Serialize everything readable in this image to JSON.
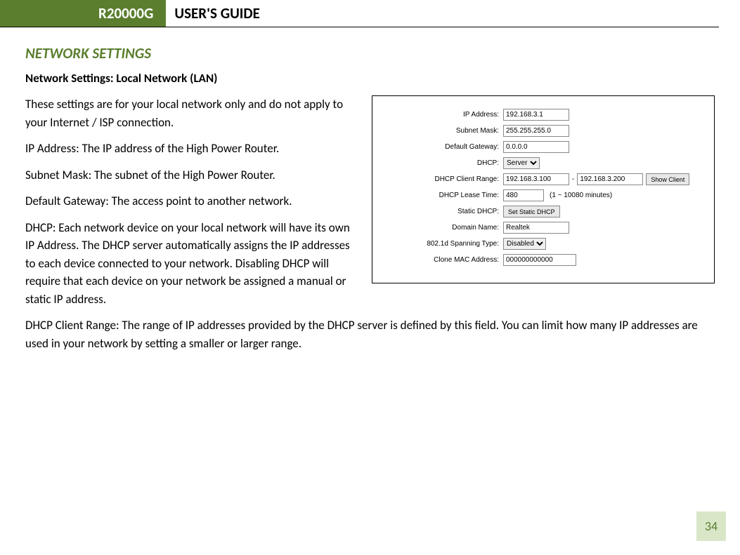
{
  "header": {
    "model": "R20000G",
    "title": "USER'S GUIDE"
  },
  "section": {
    "title": "NETWORK SETTINGS",
    "subtitle": "Network Settings: Local Network (LAN)"
  },
  "paragraphs": {
    "intro": "These settings are for your local network only and do not apply to your Internet / ISP connection.",
    "ip": "IP Address: The IP address of the High Power Router.",
    "subnet": "Subnet Mask: The subnet of the High Power Router.",
    "gateway": "Default Gateway: The access point to another network.",
    "dhcp": "DHCP: Each network device on your local network will have its own IP Address.  The DHCP server automatically assigns the IP addresses to each device connected to your network.  Disabling DHCP will require that each device on your network be assigned a manual or static IP address.",
    "range": "DHCP Client Range: The range of IP addresses provided by the DHCP server is defined by this field.  You can limit how many IP addresses are used in your network by setting a smaller or larger range."
  },
  "form": {
    "labels": {
      "ip": "IP Address:",
      "subnet": "Subnet Mask:",
      "gateway": "Default Gateway:",
      "dhcp": "DHCP:",
      "range": "DHCP Client Range:",
      "lease": "DHCP Lease Time:",
      "static": "Static DHCP:",
      "domain": "Domain Name:",
      "spanning": "802.1d Spanning Type:",
      "clone": "Clone MAC Address:"
    },
    "values": {
      "ip": "192.168.3.1",
      "subnet": "255.255.255.0",
      "gateway": "0.0.0.0",
      "dhcp_mode": "Server",
      "range_start": "192.168.3.100",
      "range_sep": "-",
      "range_end": "192.168.3.200",
      "show_client_btn": "Show Client",
      "lease": "480",
      "lease_hint": "(1 ~ 10080 minutes)",
      "static_btn": "Set Static DHCP",
      "domain": "Realtek",
      "spanning": "Disabled",
      "clone": "000000000000"
    }
  },
  "page_number": "34"
}
